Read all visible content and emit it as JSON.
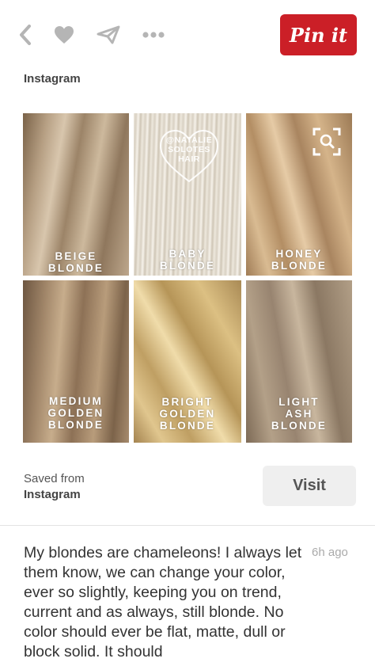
{
  "toolbar": {
    "icons": [
      "back-chevron-icon",
      "heart-icon",
      "send-icon",
      "more-dots-icon"
    ],
    "pin_button_label": "Pin it",
    "pin_color": "#cb1f27"
  },
  "pin": {
    "source_label": "Instagram",
    "watermark": "@NATALIE\nSOLOTES\nHAIR",
    "tiles": [
      {
        "label": "BEIGE\nBLONDE"
      },
      {
        "label": "BABY\nBLONDE"
      },
      {
        "label": "HONEY\nBLONDE"
      },
      {
        "label": "MEDIUM\nGOLDEN\nBLONDE"
      },
      {
        "label": "BRIGHT\nGOLDEN\nBLONDE"
      },
      {
        "label": "LIGHT\nASH\nBLONDE"
      }
    ],
    "saved_from_label": "Saved from",
    "saved_from_source": "Instagram",
    "visit_label": "Visit",
    "description": "My blondes are chameleons! I always let them know, we can change your color, ever so slightly, keeping you on trend, current and as always, still blonde. No color should ever be flat, matte, dull or block solid. It should",
    "timestamp": "6h ago"
  }
}
